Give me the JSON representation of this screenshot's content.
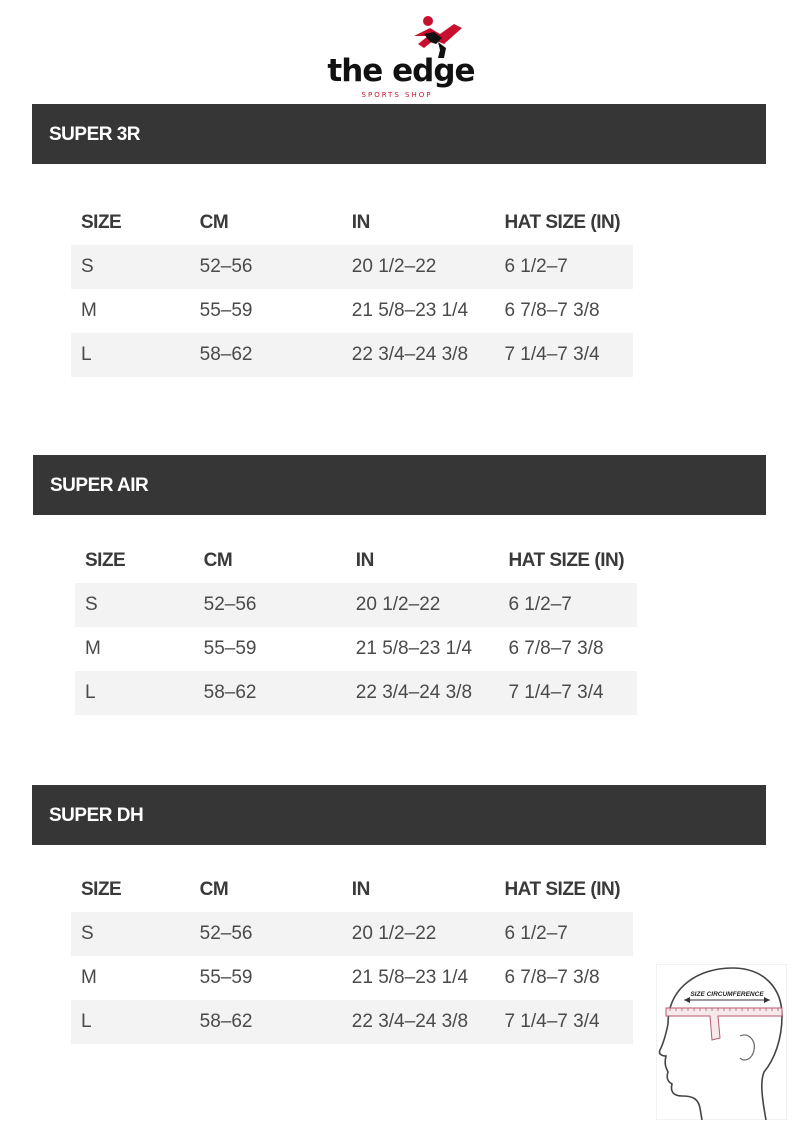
{
  "brand": {
    "name": "the edge",
    "tagline": "SPORTS SHOP",
    "colors": {
      "red": "#c8102e",
      "black": "#111111"
    }
  },
  "columns": [
    "SIZE",
    "CM",
    "IN",
    "HAT SIZE (IN)"
  ],
  "sections": [
    {
      "title": "SUPER 3R",
      "rows": [
        [
          "S",
          "52–56",
          "20 1/2–22",
          "6 1/2–7"
        ],
        [
          "M",
          "55–59",
          "21 5/8–23 1/4",
          "6 7/8–7 3/8"
        ],
        [
          "L",
          "58–62",
          "22 3/4–24 3/8",
          "7 1/4–7 3/4"
        ]
      ]
    },
    {
      "title": "SUPER AIR",
      "rows": [
        [
          "S",
          "52–56",
          "20 1/2–22",
          "6 1/2–7"
        ],
        [
          "M",
          "55–59",
          "21 5/8–23 1/4",
          "6 7/8–7 3/8"
        ],
        [
          "L",
          "58–62",
          "22 3/4–24 3/8",
          "7 1/4–7 3/4"
        ]
      ]
    },
    {
      "title": "SUPER DH",
      "rows": [
        [
          "S",
          "52–56",
          "20 1/2–22",
          "6 1/2–7"
        ],
        [
          "M",
          "55–59",
          "21 5/8–23 1/4",
          "6 7/8–7 3/8"
        ],
        [
          "L",
          "58–62",
          "22 3/4–24 3/8",
          "7 1/4–7 3/4"
        ]
      ]
    }
  ],
  "illustration": {
    "label": "SIZE CIRCUMFERENCE"
  },
  "theme": {
    "bar": "#363636",
    "shaded_row": "#f3f3f3",
    "text": "#4a4a4a"
  }
}
